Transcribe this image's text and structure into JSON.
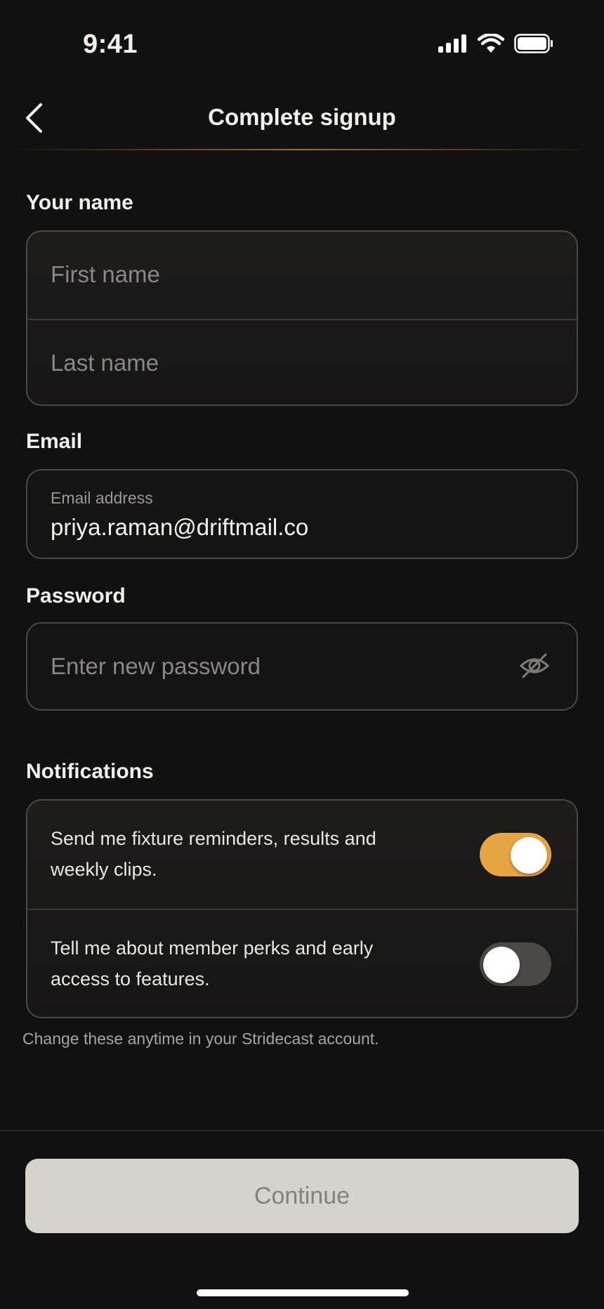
{
  "status_bar": {
    "time": "9:41",
    "icons": [
      "cellular-signal-icon",
      "wifi-icon",
      "battery-icon"
    ]
  },
  "nav": {
    "title": "Complete signup",
    "back_icon": "chevron-left-icon"
  },
  "name_section": {
    "label": "Your name",
    "first_name": {
      "value": "",
      "placeholder": "First name"
    },
    "last_name": {
      "value": "",
      "placeholder": "Last name"
    }
  },
  "email_section": {
    "label": "Email",
    "caption": "Email address",
    "value": "priya.raman@driftmail.co"
  },
  "password_section": {
    "label": "Password",
    "value": "",
    "placeholder": "Enter new password",
    "visibility_icon": "eye-off-icon"
  },
  "notifications": {
    "label": "Notifications",
    "items": [
      {
        "text": "Send me fixture reminders, results and weekly clips.",
        "enabled": true
      },
      {
        "text": "Tell me about member perks and early access to features.",
        "enabled": false
      }
    ],
    "helper": "Change these anytime in your Stridecast account."
  },
  "footer": {
    "continue_label": "Continue"
  },
  "colors": {
    "accent": "#e7a443",
    "toggle_off": "#4b4845",
    "background": "#121111"
  }
}
